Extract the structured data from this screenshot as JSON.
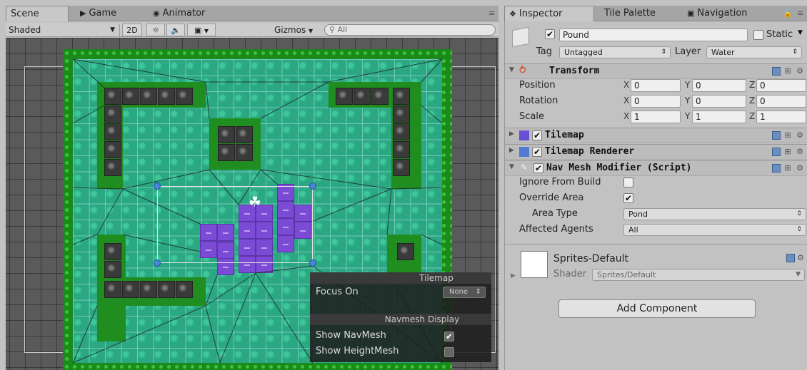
{
  "scene_tabs": {
    "scene": "Scene",
    "game": "Game",
    "animator": "Animator"
  },
  "scene_toolbar": {
    "shading": "Shaded",
    "mode_2d": "2D",
    "gizmos": "Gizmos",
    "search_placeholder": "All"
  },
  "overlay": {
    "tilemap_title": "Tilemap",
    "focus_on_label": "Focus On",
    "focus_on_value": "None",
    "navmesh_title": "Navmesh Display",
    "show_navmesh_label": "Show NavMesh",
    "show_navmesh_checked": true,
    "show_heightmesh_label": "Show HeightMesh",
    "show_heightmesh_checked": false
  },
  "inspector_tabs": {
    "inspector": "Inspector",
    "tile_palette": "Tile Palette",
    "navigation": "Navigation"
  },
  "object": {
    "name": "Pound",
    "active": true,
    "static_label": "Static",
    "tag_label": "Tag",
    "tag_value": "Untagged",
    "layer_label": "Layer",
    "layer_value": "Water"
  },
  "transform": {
    "title": "Transform",
    "position_label": "Position",
    "rotation_label": "Rotation",
    "scale_label": "Scale",
    "x": "X",
    "y": "Y",
    "z": "Z",
    "position": {
      "x": "0",
      "y": "0",
      "z": "0"
    },
    "rotation": {
      "x": "0",
      "y": "0",
      "z": "0"
    },
    "scale": {
      "x": "1",
      "y": "1",
      "z": "1"
    }
  },
  "components": {
    "tilemap": "Tilemap",
    "tilemap_renderer": "Tilemap Renderer",
    "nav_mesh_modifier": "Nav Mesh Modifier (Script)"
  },
  "nav_mesh_modifier": {
    "ignore_from_build_label": "Ignore From Build",
    "ignore_from_build": false,
    "override_area_label": "Override Area",
    "override_area": true,
    "area_type_label": "Area Type",
    "area_type_value": "Pond",
    "affected_agents_label": "Affected Agents",
    "affected_agents_value": "All"
  },
  "material": {
    "name": "Sprites-Default",
    "shader_label": "Shader",
    "shader_value": "Sprites/Default"
  },
  "add_component": "Add Component",
  "colors": {
    "grass": "#1a8a1a",
    "water": "#2ba882",
    "pond": "#7c4bd6",
    "rock": "#3a3a3a",
    "navmesh_line": "#1b2b2b"
  }
}
